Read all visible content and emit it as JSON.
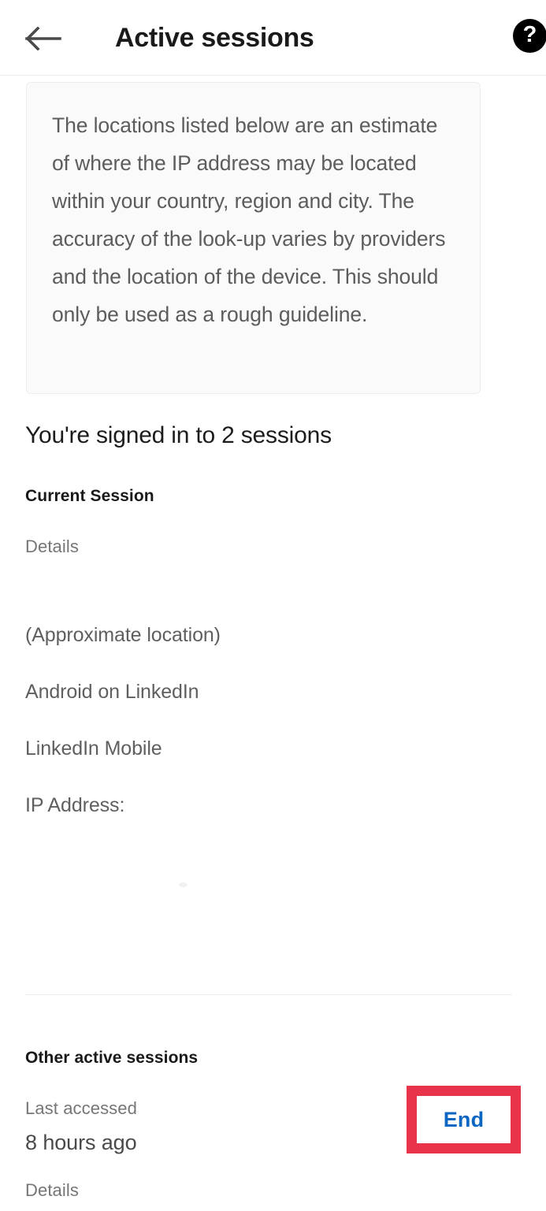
{
  "header": {
    "title": "Active sessions",
    "back_icon": "arrow-left-icon",
    "help_icon": "help-circle-icon",
    "help_glyph": "?"
  },
  "info_card": {
    "text": "The locations listed below are an estimate of where the IP address may be located within your country, region and city. The accuracy of the look-up varies by providers and the location of the device. This should only be used as a rough guideline."
  },
  "main": {
    "signed_in_heading": "You're signed in to 2 sessions",
    "current_session": {
      "label": "Current Session",
      "details_label": "Details",
      "lines": [
        "(Approximate location)",
        "Android on LinkedIn",
        "LinkedIn Mobile",
        "IP Address:"
      ]
    },
    "other_sessions": {
      "label": "Other active sessions",
      "last_accessed_label": "Last accessed",
      "last_accessed_value": "8 hours ago",
      "details_label": "Details",
      "end_button_label": "End"
    }
  },
  "colors": {
    "accent_link": "#0a66c2",
    "annotation": "#e8334a",
    "text_primary": "#1a1a1a",
    "text_secondary": "#5f5f5f",
    "text_muted": "#767676",
    "card_bg": "#fafafa",
    "divider": "#ededed"
  }
}
